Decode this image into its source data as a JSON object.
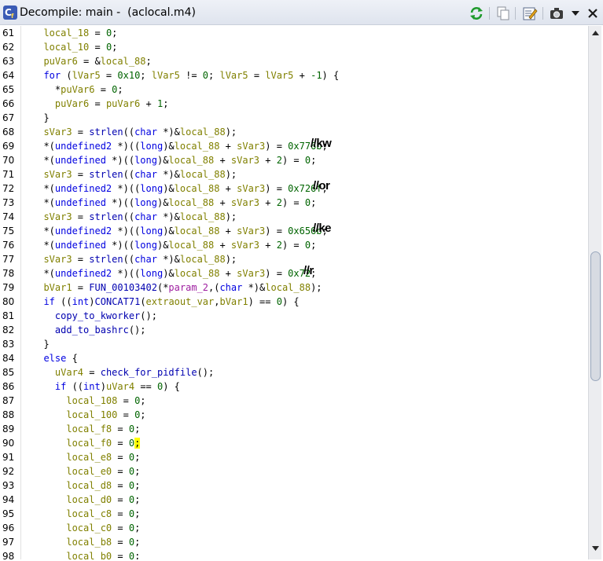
{
  "window": {
    "title": "Decompile: main -  (aclocal.m4)",
    "buttons": {
      "refresh": "refresh-icon",
      "copy": "copy-icon",
      "edit": "edit-function-signature-icon",
      "snapshot": "snapshot-icon",
      "menu": "menu-chevron-down-icon",
      "close": "close-icon"
    }
  },
  "code_lines": [
    {
      "n": "61",
      "tokens": [
        [
          "  local_18",
          "v"
        ],
        [
          " = ",
          ""
        ],
        [
          "0",
          "n"
        ],
        [
          ";",
          ""
        ]
      ]
    },
    {
      "n": "62",
      "tokens": [
        [
          "  local_10",
          "v"
        ],
        [
          " = ",
          ""
        ],
        [
          "0",
          "n"
        ],
        [
          ";",
          ""
        ]
      ]
    },
    {
      "n": "63",
      "tokens": [
        [
          "  puVar6",
          "v"
        ],
        [
          " = &",
          ""
        ],
        [
          "local_88",
          "v"
        ],
        [
          ";",
          ""
        ]
      ]
    },
    {
      "n": "64",
      "tokens": [
        [
          "  for",
          "k"
        ],
        [
          " (",
          ""
        ],
        [
          "lVar5",
          "v"
        ],
        [
          " = ",
          ""
        ],
        [
          "0x10",
          "n"
        ],
        [
          "; ",
          ""
        ],
        [
          "lVar5",
          "v"
        ],
        [
          " != ",
          ""
        ],
        [
          "0",
          "n"
        ],
        [
          "; ",
          ""
        ],
        [
          "lVar5",
          "v"
        ],
        [
          " = ",
          ""
        ],
        [
          "lVar5",
          "v"
        ],
        [
          " + ",
          ""
        ],
        [
          "-1",
          "n"
        ],
        [
          ") {",
          ""
        ]
      ]
    },
    {
      "n": "65",
      "tokens": [
        [
          "    *",
          ""
        ],
        [
          "puVar6",
          "v"
        ],
        [
          " = ",
          ""
        ],
        [
          "0",
          "n"
        ],
        [
          ";",
          ""
        ]
      ]
    },
    {
      "n": "66",
      "tokens": [
        [
          "    puVar6",
          "v"
        ],
        [
          " = ",
          ""
        ],
        [
          "puVar6",
          "v"
        ],
        [
          " + ",
          ""
        ],
        [
          "1",
          "n"
        ],
        [
          ";",
          ""
        ]
      ]
    },
    {
      "n": "67",
      "tokens": [
        [
          "  }",
          ""
        ]
      ]
    },
    {
      "n": "68",
      "tokens": [
        [
          "  sVar3",
          "v"
        ],
        [
          " = ",
          ""
        ],
        [
          "strlen",
          "f"
        ],
        [
          "((",
          ""
        ],
        [
          "char",
          "t"
        ],
        [
          " *)&",
          ""
        ],
        [
          "local_88",
          "v"
        ],
        [
          ");",
          ""
        ]
      ]
    },
    {
      "n": "69",
      "tokens": [
        [
          "  *(",
          ""
        ],
        [
          "undefined2",
          "t"
        ],
        [
          " *)((",
          ""
        ],
        [
          "long",
          "t"
        ],
        [
          ")&",
          ""
        ],
        [
          "local_88",
          "v"
        ],
        [
          " + ",
          ""
        ],
        [
          "sVar3",
          "v"
        ],
        [
          ") = ",
          ""
        ],
        [
          "0x776b",
          "n"
        ],
        [
          ";",
          ""
        ]
      ],
      "note": "//kw"
    },
    {
      "n": "70",
      "tokens": [
        [
          "  *(",
          ""
        ],
        [
          "undefined",
          "t"
        ],
        [
          " *)((",
          ""
        ],
        [
          "long",
          "t"
        ],
        [
          ")&",
          ""
        ],
        [
          "local_88",
          "v"
        ],
        [
          " + ",
          ""
        ],
        [
          "sVar3",
          "v"
        ],
        [
          " + ",
          ""
        ],
        [
          "2",
          "n"
        ],
        [
          ") = ",
          ""
        ],
        [
          "0",
          "n"
        ],
        [
          ";",
          ""
        ]
      ]
    },
    {
      "n": "71",
      "tokens": [
        [
          "  sVar3",
          "v"
        ],
        [
          " = ",
          ""
        ],
        [
          "strlen",
          "f"
        ],
        [
          "((",
          ""
        ],
        [
          "char",
          "t"
        ],
        [
          " *)&",
          ""
        ],
        [
          "local_88",
          "v"
        ],
        [
          ");",
          ""
        ]
      ]
    },
    {
      "n": "72",
      "tokens": [
        [
          "  *(",
          ""
        ],
        [
          "undefined2",
          "t"
        ],
        [
          " *)((",
          ""
        ],
        [
          "long",
          "t"
        ],
        [
          ")&",
          ""
        ],
        [
          "local_88",
          "v"
        ],
        [
          " + ",
          ""
        ],
        [
          "sVar3",
          "v"
        ],
        [
          ") = ",
          ""
        ],
        [
          "0x726f",
          "n"
        ],
        [
          ";",
          ""
        ]
      ],
      "note": "//or"
    },
    {
      "n": "73",
      "tokens": [
        [
          "  *(",
          ""
        ],
        [
          "undefined",
          "t"
        ],
        [
          " *)((",
          ""
        ],
        [
          "long",
          "t"
        ],
        [
          ")&",
          ""
        ],
        [
          "local_88",
          "v"
        ],
        [
          " + ",
          ""
        ],
        [
          "sVar3",
          "v"
        ],
        [
          " + ",
          ""
        ],
        [
          "2",
          "n"
        ],
        [
          ") = ",
          ""
        ],
        [
          "0",
          "n"
        ],
        [
          ";",
          ""
        ]
      ]
    },
    {
      "n": "74",
      "tokens": [
        [
          "  sVar3",
          "v"
        ],
        [
          " = ",
          ""
        ],
        [
          "strlen",
          "f"
        ],
        [
          "((",
          ""
        ],
        [
          "char",
          "t"
        ],
        [
          " *)&",
          ""
        ],
        [
          "local_88",
          "v"
        ],
        [
          ");",
          ""
        ]
      ]
    },
    {
      "n": "75",
      "tokens": [
        [
          "  *(",
          ""
        ],
        [
          "undefined2",
          "t"
        ],
        [
          " *)((",
          ""
        ],
        [
          "long",
          "t"
        ],
        [
          ")&",
          ""
        ],
        [
          "local_88",
          "v"
        ],
        [
          " + ",
          ""
        ],
        [
          "sVar3",
          "v"
        ],
        [
          ") = ",
          ""
        ],
        [
          "0x656b",
          "n"
        ],
        [
          ";",
          ""
        ]
      ],
      "note": "//ke"
    },
    {
      "n": "76",
      "tokens": [
        [
          "  *(",
          ""
        ],
        [
          "undefined",
          "t"
        ],
        [
          " *)((",
          ""
        ],
        [
          "long",
          "t"
        ],
        [
          ")&",
          ""
        ],
        [
          "local_88",
          "v"
        ],
        [
          " + ",
          ""
        ],
        [
          "sVar3",
          "v"
        ],
        [
          " + ",
          ""
        ],
        [
          "2",
          "n"
        ],
        [
          ") = ",
          ""
        ],
        [
          "0",
          "n"
        ],
        [
          ";",
          ""
        ]
      ]
    },
    {
      "n": "77",
      "tokens": [
        [
          "  sVar3",
          "v"
        ],
        [
          " = ",
          ""
        ],
        [
          "strlen",
          "f"
        ],
        [
          "((",
          ""
        ],
        [
          "char",
          "t"
        ],
        [
          " *)&",
          ""
        ],
        [
          "local_88",
          "v"
        ],
        [
          ");",
          ""
        ]
      ]
    },
    {
      "n": "78",
      "tokens": [
        [
          "  *(",
          ""
        ],
        [
          "undefined2",
          "t"
        ],
        [
          " *)((",
          ""
        ],
        [
          "long",
          "t"
        ],
        [
          ")&",
          ""
        ],
        [
          "local_88",
          "v"
        ],
        [
          " + ",
          ""
        ],
        [
          "sVar3",
          "v"
        ],
        [
          ") = ",
          ""
        ],
        [
          "0x72",
          "n"
        ],
        [
          ";",
          ""
        ]
      ],
      "note": "//r"
    },
    {
      "n": "79",
      "tokens": [
        [
          "  bVar1",
          "v"
        ],
        [
          " = ",
          ""
        ],
        [
          "FUN_00103402",
          "f"
        ],
        [
          "(*",
          ""
        ],
        [
          "param_2",
          "p"
        ],
        [
          ",(",
          ""
        ],
        [
          "char",
          "t"
        ],
        [
          " *)&",
          ""
        ],
        [
          "local_88",
          "v"
        ],
        [
          ");",
          ""
        ]
      ]
    },
    {
      "n": "80",
      "tokens": [
        [
          "  if",
          "k"
        ],
        [
          " ((",
          ""
        ],
        [
          "int",
          "t"
        ],
        [
          ")",
          ""
        ],
        [
          "CONCAT71",
          "f"
        ],
        [
          "(",
          ""
        ],
        [
          "extraout_var",
          "v"
        ],
        [
          ",",
          ""
        ],
        [
          "bVar1",
          "v"
        ],
        [
          ") == ",
          ""
        ],
        [
          "0",
          "n"
        ],
        [
          ") {",
          ""
        ]
      ]
    },
    {
      "n": "81",
      "tokens": [
        [
          "    copy_to_kworker",
          "f"
        ],
        [
          "();",
          ""
        ]
      ]
    },
    {
      "n": "82",
      "tokens": [
        [
          "    add_to_bashrc",
          "f"
        ],
        [
          "();",
          ""
        ]
      ]
    },
    {
      "n": "83",
      "tokens": [
        [
          "  }",
          ""
        ]
      ]
    },
    {
      "n": "84",
      "tokens": [
        [
          "  else",
          "k"
        ],
        [
          " {",
          ""
        ]
      ]
    },
    {
      "n": "85",
      "tokens": [
        [
          "    uVar4",
          "v"
        ],
        [
          " = ",
          ""
        ],
        [
          "check_for_pidfile",
          "f"
        ],
        [
          "();",
          ""
        ]
      ]
    },
    {
      "n": "86",
      "tokens": [
        [
          "    if",
          "k"
        ],
        [
          " ((",
          ""
        ],
        [
          "int",
          "t"
        ],
        [
          ")",
          ""
        ],
        [
          "uVar4",
          "v"
        ],
        [
          " == ",
          ""
        ],
        [
          "0",
          "n"
        ],
        [
          ") {",
          ""
        ]
      ]
    },
    {
      "n": "87",
      "tokens": [
        [
          "      local_108",
          "v"
        ],
        [
          " = ",
          ""
        ],
        [
          "0",
          "n"
        ],
        [
          ";",
          ""
        ]
      ]
    },
    {
      "n": "88",
      "tokens": [
        [
          "      local_100",
          "v"
        ],
        [
          " = ",
          ""
        ],
        [
          "0",
          "n"
        ],
        [
          ";",
          ""
        ]
      ]
    },
    {
      "n": "89",
      "tokens": [
        [
          "      local_f8",
          "v"
        ],
        [
          " = ",
          ""
        ],
        [
          "0",
          "n"
        ],
        [
          ";",
          ""
        ]
      ]
    },
    {
      "n": "90",
      "tokens": [
        [
          "      local_f0",
          "v"
        ],
        [
          " = ",
          ""
        ],
        [
          "0",
          "n"
        ],
        [
          ";",
          "hl"
        ]
      ]
    },
    {
      "n": "91",
      "tokens": [
        [
          "      local_e8",
          "v"
        ],
        [
          " = ",
          ""
        ],
        [
          "0",
          "n"
        ],
        [
          ";",
          ""
        ]
      ]
    },
    {
      "n": "92",
      "tokens": [
        [
          "      local_e0",
          "v"
        ],
        [
          " = ",
          ""
        ],
        [
          "0",
          "n"
        ],
        [
          ";",
          ""
        ]
      ]
    },
    {
      "n": "93",
      "tokens": [
        [
          "      local_d8",
          "v"
        ],
        [
          " = ",
          ""
        ],
        [
          "0",
          "n"
        ],
        [
          ";",
          ""
        ]
      ]
    },
    {
      "n": "94",
      "tokens": [
        [
          "      local_d0",
          "v"
        ],
        [
          " = ",
          ""
        ],
        [
          "0",
          "n"
        ],
        [
          ";",
          ""
        ]
      ]
    },
    {
      "n": "95",
      "tokens": [
        [
          "      local_c8",
          "v"
        ],
        [
          " = ",
          ""
        ],
        [
          "0",
          "n"
        ],
        [
          ";",
          ""
        ]
      ]
    },
    {
      "n": "96",
      "tokens": [
        [
          "      local_c0",
          "v"
        ],
        [
          " = ",
          ""
        ],
        [
          "0",
          "n"
        ],
        [
          ";",
          ""
        ]
      ]
    },
    {
      "n": "97",
      "tokens": [
        [
          "      local_b8",
          "v"
        ],
        [
          " = ",
          ""
        ],
        [
          "0",
          "n"
        ],
        [
          ";",
          ""
        ]
      ]
    },
    {
      "n": "98",
      "tokens": [
        [
          "      local_b0",
          "v"
        ],
        [
          " = ",
          ""
        ],
        [
          "0",
          "n"
        ],
        [
          ";",
          ""
        ]
      ]
    }
  ],
  "colors": {
    "keyword": "#0000e0",
    "variable": "#808000",
    "function": "#0000b0",
    "number": "#006400",
    "parameter": "#9e1ea0",
    "cursor_highlight": "#ffff00"
  }
}
